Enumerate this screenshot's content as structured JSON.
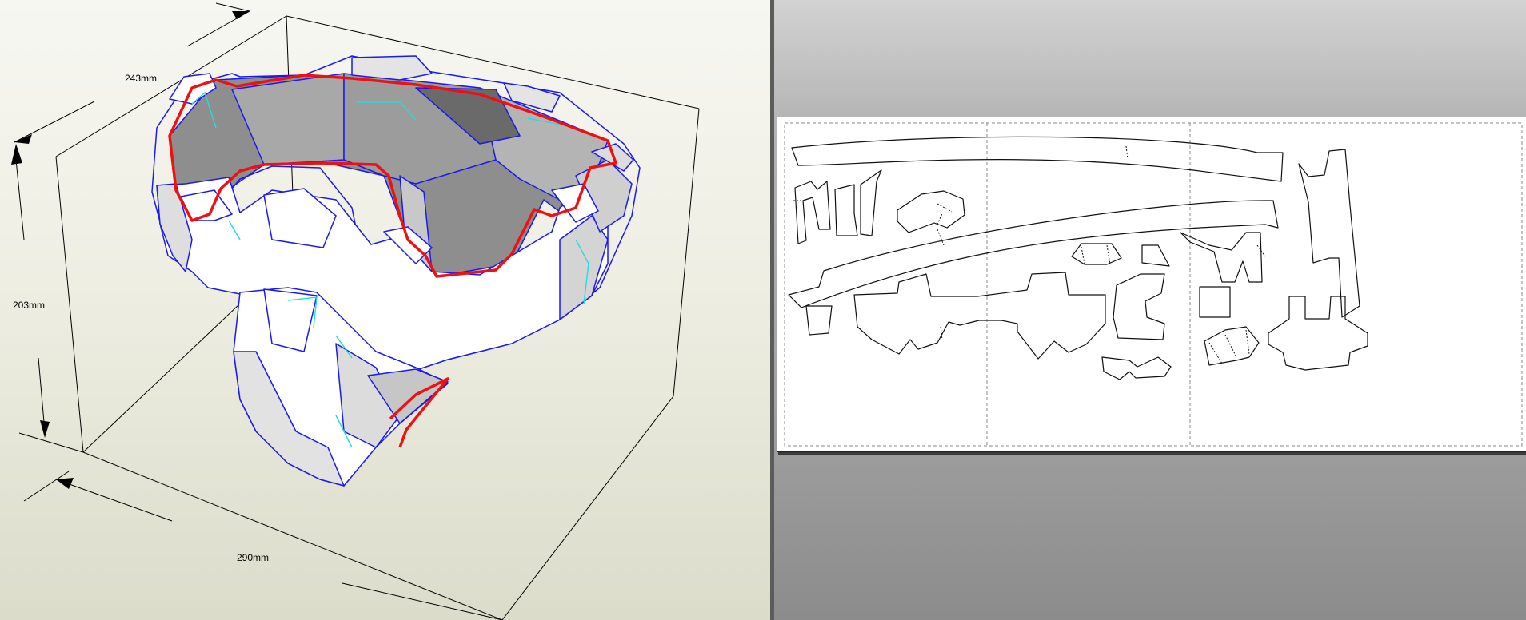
{
  "view3d": {
    "dimension_width_label": "243mm",
    "dimension_height_label": "203mm",
    "dimension_depth_label": "290mm"
  },
  "view2d": {
    "sheet_pages": 3
  },
  "colors": {
    "model_edge": "#1a1aee",
    "cut_line": "#ee1111",
    "fold_line": "#22dddd",
    "box_line": "#000000",
    "view3d_background": "#eeeee3",
    "view2d_background": "#a8a8a8"
  }
}
